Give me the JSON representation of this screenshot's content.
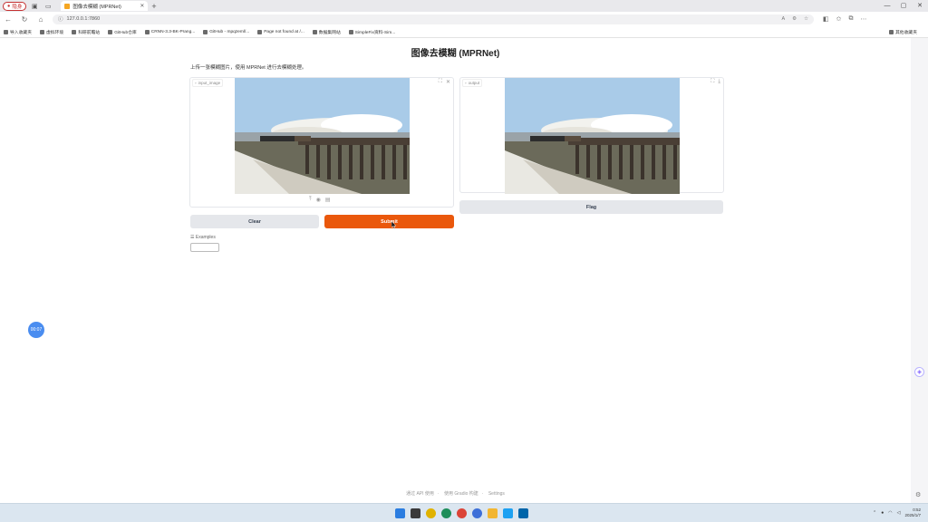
{
  "browser": {
    "profile_label": "隐身",
    "tab_title": "图像去模糊 (MPRNet)",
    "url": "127.0.0.1:7860",
    "bookmarks": [
      "导入收藏夹",
      "虚拟环境",
      "科研前瞻站",
      "GitHub仓库",
      "CRNN-3.3-BK-Prang...",
      "GitHub - mpqzeml/...",
      "Page not found at /...",
      "数据集网站",
      "SimpleFix资料-Sim..."
    ],
    "bookmarks_right": "其他收藏夹"
  },
  "app": {
    "title": "图像去模糊 (MPRNet)",
    "description": "上传一张模糊图片，使用 MPRNet 进行去模糊处理。",
    "input_label": "input_image",
    "output_label": "output",
    "clear_label": "Clear",
    "submit_label": "Submit",
    "flag_label": "Flag",
    "examples_label": "☰ Examples",
    "footer": {
      "api": "通过 API 使用",
      "built": "使用 Gradio 构建",
      "settings": "Settings"
    }
  },
  "overlay": {
    "timer": "00:07"
  },
  "taskbar": {
    "time": "0:52",
    "date": "2025/1/7"
  },
  "colors": {
    "accent": "#ea580c",
    "button_gray": "#e5e7eb"
  }
}
